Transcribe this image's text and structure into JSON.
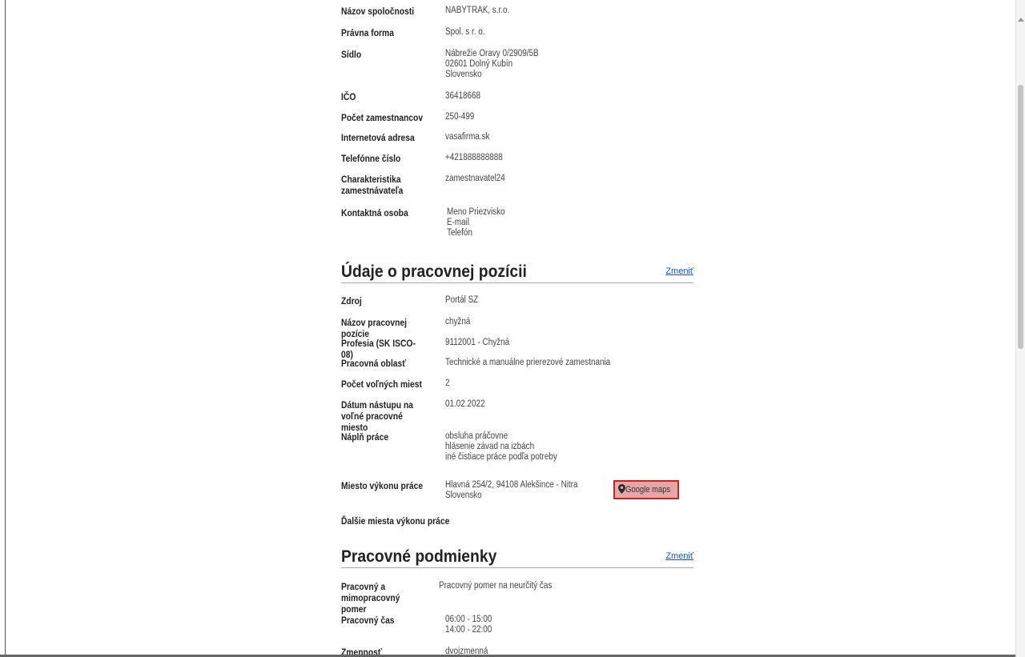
{
  "company": {
    "rows": [
      {
        "label": "Názov spoločnosti",
        "lines": [
          "NABYTRAK, s.r.o."
        ]
      },
      {
        "label": "Právna forma",
        "lines": [
          "Spol. s r. o."
        ]
      },
      {
        "label": "Sídlo",
        "lines": [
          "Nábrežie Oravy 0/2909/5B",
          "02601 Dolný Kubín",
          "Slovensko"
        ]
      },
      {
        "label": "IČO",
        "lines": [
          "36418668"
        ]
      },
      {
        "label": "Počet zamestnancov",
        "lines": [
          "250-499"
        ]
      },
      {
        "label": "Internetová adresa",
        "lines": [
          "vasafirma.sk"
        ]
      },
      {
        "label": "Telefónne číslo",
        "lines": [
          "+421888888888"
        ]
      },
      {
        "label": "Charakteristika zamestnávateľa",
        "lines": [
          "zamestnavatel24"
        ]
      },
      {
        "label": "Kontaktná osoba",
        "lines": [
          "Meno Priezvisko",
          "E-mail",
          "Telefón"
        ]
      }
    ]
  },
  "position": {
    "title": "Údaje o pracovnej pozícii",
    "change_label": "Zmeniť",
    "rows": [
      {
        "label": "Zdroj",
        "lines": [
          "Portál SZ"
        ]
      },
      {
        "label": "Názov pracovnej pozície",
        "lines": [
          "chyžná"
        ]
      },
      {
        "label": "Profesia (SK ISCO-08)",
        "lines": [
          "9112001 - Chyžná"
        ]
      },
      {
        "label": "Pracovná oblasť",
        "lines": [
          "Technické a manuálne prierezové zamestnania"
        ]
      },
      {
        "label": "Počet voľných miest",
        "lines": [
          "2"
        ]
      },
      {
        "label": "Dátum nástupu na voľné pracovné miesto",
        "lines": [
          "01.02.2022"
        ]
      },
      {
        "label": "Náplň práce",
        "lines": [
          "obsluha práčovne",
          "hlásenie závad na izbách",
          "iné čistiace práce podľa potreby"
        ]
      },
      {
        "label": "Miesto výkonu práce",
        "lines": [
          "Hlavná 254/2, 94108 Alekšince - Nitra",
          "Slovensko"
        ]
      },
      {
        "label": "Ďalšie miesta výkonu práce",
        "lines": []
      }
    ],
    "maps_button": {
      "label": "Google maps",
      "icon": "map-pin-icon"
    }
  },
  "conditions": {
    "title": "Pracovné podmienky",
    "change_label": "Zmeniť",
    "rows": [
      {
        "label": "Pracovný a mimopracovný pomer",
        "lines": [
          "Pracovný pomer na neurčitý čas"
        ]
      },
      {
        "label": "Pracovný čas",
        "lines": [
          "06:00 - 15:00",
          "14:00 - 22:00"
        ]
      },
      {
        "label": "Zmennosť",
        "lines": [
          "dvojzmenná"
        ]
      }
    ]
  },
  "colors": {
    "accent_link": "#1a4fd6",
    "highlight_border": "#cc1f1f",
    "highlight_fill": "#e5a6a6"
  }
}
